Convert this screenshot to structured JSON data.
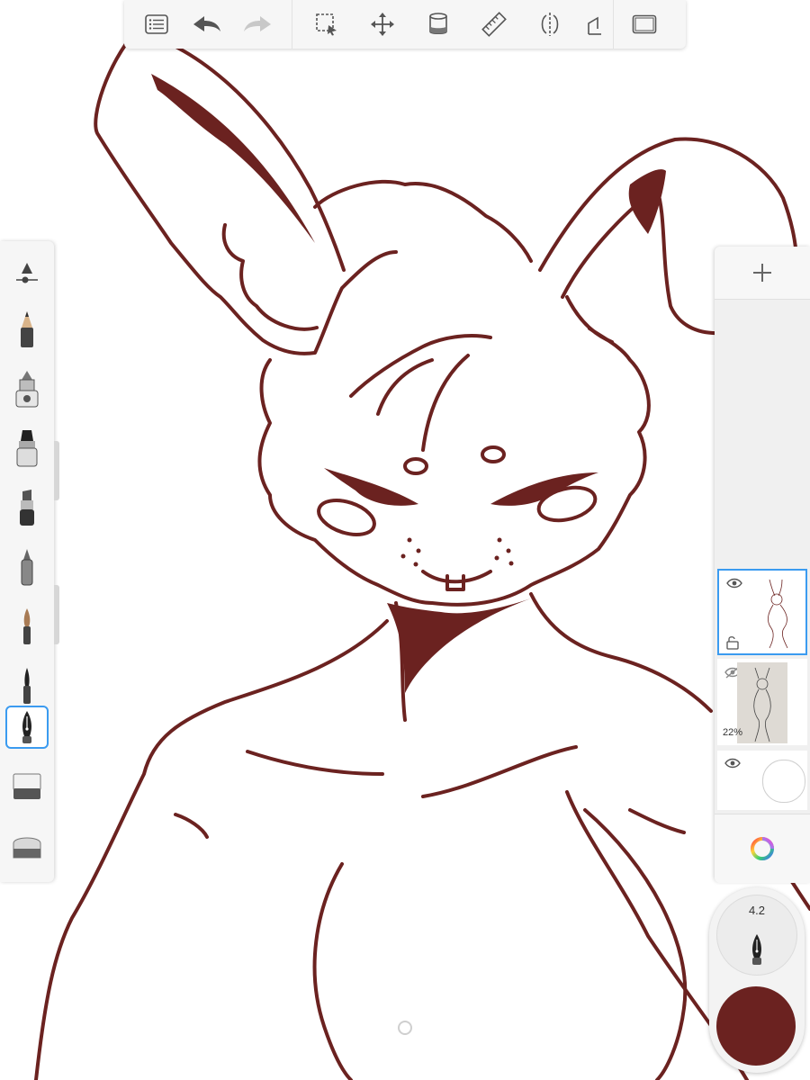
{
  "toolbar": {
    "icons": [
      "list-icon",
      "undo-icon",
      "redo-icon",
      "selection-icon",
      "transform-icon",
      "fill-bucket-icon",
      "ruler-icon",
      "symmetry-icon",
      "perspective-icon",
      "fullscreen-icon"
    ]
  },
  "brushes": {
    "items": [
      "pencil",
      "airbrush",
      "marker",
      "chisel-marker",
      "ballpoint-pen",
      "paintbrush",
      "fine-brush",
      "ink-pen",
      "eraser",
      "soft-eraser"
    ],
    "selected": "ink-pen",
    "icons": [
      "brush-settings-icon"
    ]
  },
  "layers": {
    "add_icon": "plus-icon",
    "items": [
      {
        "name": "lineart-layer",
        "visible": true,
        "locked": false,
        "active": true,
        "opacity_label": ""
      },
      {
        "name": "sketch-layer",
        "visible": false,
        "locked": false,
        "active": false,
        "opacity_label": "22%"
      },
      {
        "name": "background-layer",
        "visible": true,
        "locked": false,
        "active": false,
        "opacity_label": ""
      }
    ],
    "color_icon": "color-wheel-icon"
  },
  "puck": {
    "size_label": "4.2",
    "color": "#6b2220"
  },
  "colors": {
    "ink": "#6b2220",
    "accent": "#3b9bf0"
  }
}
